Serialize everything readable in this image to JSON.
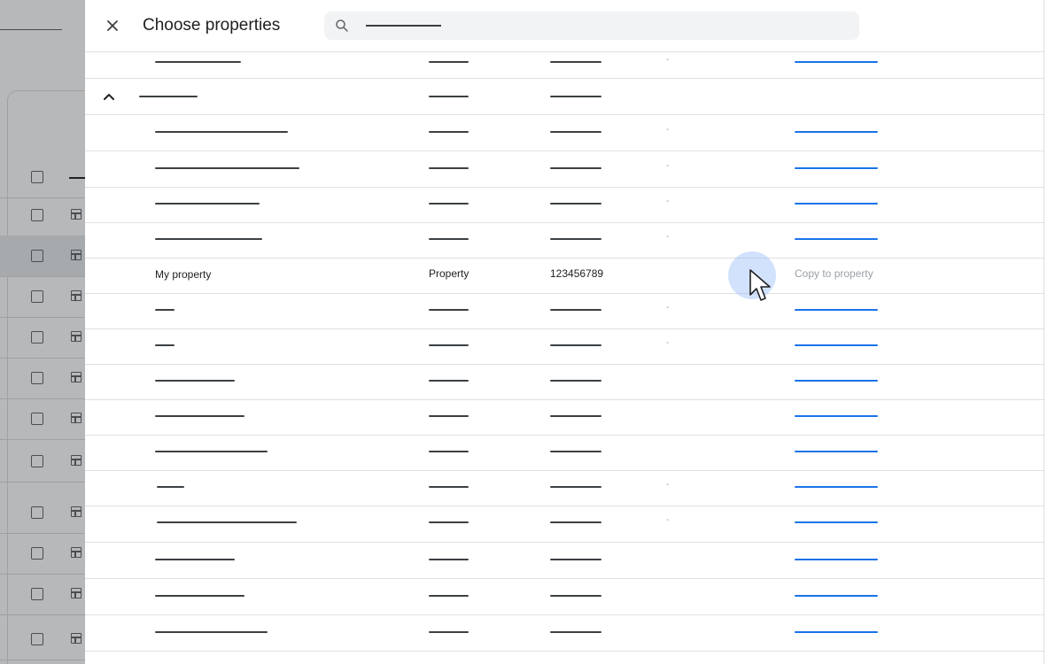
{
  "panel": {
    "title": "Choose properties",
    "close_icon": "close-icon",
    "search_icon": "search-icon"
  },
  "group_row": {
    "icon": "chevron-up-icon"
  },
  "highlight_row": {
    "name": "My property",
    "type": "Property",
    "id": "123456789",
    "action": "Copy to property"
  },
  "colors": {
    "link_blue": "#1a73e8",
    "text": "#202124",
    "divider": "#e0e0e0",
    "scrim": "rgba(32,33,36,0.32)",
    "search_bg": "#f1f3f4"
  }
}
